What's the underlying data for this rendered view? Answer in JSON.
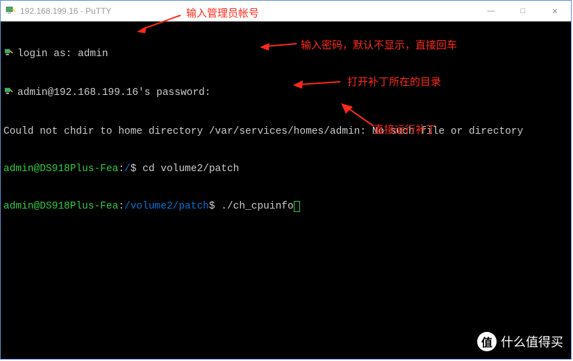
{
  "window": {
    "title": "192.168.199.16 - PuTTY",
    "minimize": "—",
    "maximize": "□",
    "close": "✕"
  },
  "terminal": {
    "login_prompt": "login as: ",
    "login_user": "admin",
    "password_prompt": "admin@192.168.199.16's password:",
    "error_line": "Could not chdir to home directory /var/services/homes/admin: No such file or directory",
    "prompt1_user": "admin@DS918Plus-Fea",
    "prompt1_path": "/",
    "prompt1_cmd": "cd volume2/patch",
    "prompt2_user": "admin@DS918Plus-Fea",
    "prompt2_path": "/volume2/patch",
    "prompt2_cmd": "./ch_cpuinfo",
    "dollar": "$"
  },
  "annotations": {
    "a1": "输入管理员帐号",
    "a2": "输入密码，默认不显示，直接回车",
    "a3": "打开补丁所在的目录",
    "a4": "直接运行补丁"
  },
  "watermark": {
    "badge": "值",
    "text": "什么值得买"
  }
}
